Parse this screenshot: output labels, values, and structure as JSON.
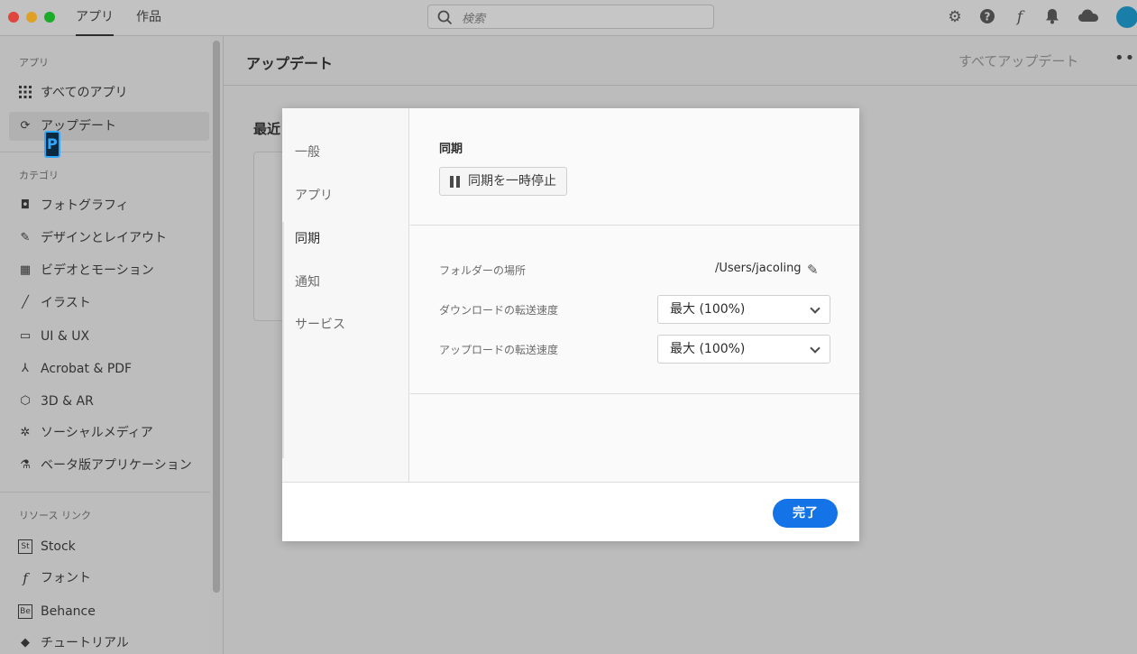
{
  "topbar": {
    "tabs": [
      "アプリ",
      "作品"
    ],
    "search_placeholder": "検索",
    "icons": [
      "gear-icon",
      "help-icon",
      "fonts-icon",
      "bell-icon",
      "cloud-icon",
      "avatar"
    ]
  },
  "sidebar": {
    "section_apps": "アプリ",
    "apps_items": [
      {
        "label": "すべてのアプリ",
        "icon": "grid-icon"
      },
      {
        "label": "アップデート",
        "icon": "refresh-icon"
      }
    ],
    "section_categories": "カテゴリ",
    "category_items": [
      {
        "label": "フォトグラフィ",
        "icon": "camera-icon"
      },
      {
        "label": "デザインとレイアウト",
        "icon": "design-icon"
      },
      {
        "label": "ビデオとモーション",
        "icon": "video-icon"
      },
      {
        "label": "イラスト",
        "icon": "brush-icon"
      },
      {
        "label": "UI & UX",
        "icon": "uiux-icon"
      },
      {
        "label": "Acrobat & PDF",
        "icon": "acrobat-icon"
      },
      {
        "label": "3D & AR",
        "icon": "cube-icon"
      },
      {
        "label": "ソーシャルメディア",
        "icon": "social-icon"
      },
      {
        "label": "ベータ版アプリケーション",
        "icon": "flask-icon"
      }
    ],
    "section_resources": "リソース リンク",
    "resource_items": [
      {
        "label": "Stock",
        "icon": "stock-icon"
      },
      {
        "label": "フォント",
        "icon": "font-icon"
      },
      {
        "label": "Behance",
        "icon": "behance-icon"
      },
      {
        "label": "チュートリアル",
        "icon": "tutorial-icon"
      }
    ]
  },
  "main": {
    "title": "アップデート",
    "update_all": "すべてアップデート",
    "recent_heading": "最近"
  },
  "modal": {
    "nav": [
      "一般",
      "アプリ",
      "同期",
      "通知",
      "サービス"
    ],
    "active_nav": "同期",
    "sync_title": "同期",
    "pause_button": "同期を一時停止",
    "folder_label": "フォルダーの場所",
    "folder_path": "/Users/jacoling",
    "download_label": "ダウンロードの転送速度",
    "download_value": "最大 (100%)",
    "upload_label": "アップロードの転送速度",
    "upload_value": "最大 (100%)",
    "done_button": "完了"
  },
  "colors": {
    "accent": "#1473e6",
    "overlay": "#bcbcbc"
  }
}
